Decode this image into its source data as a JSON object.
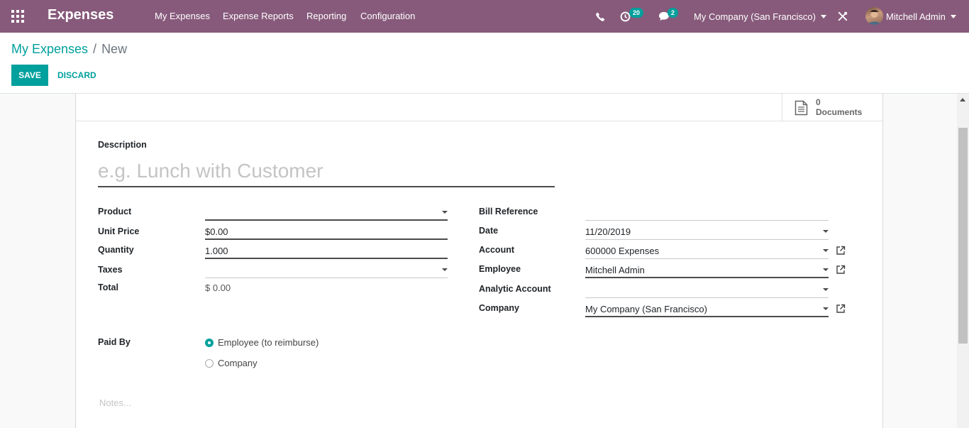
{
  "navbar": {
    "app_name": "Expenses",
    "menus": [
      "My Expenses",
      "Expense Reports",
      "Reporting",
      "Configuration"
    ],
    "activity_count": "20",
    "message_count": "2",
    "company": "My Company (San Francisco)",
    "user": "Mitchell Admin",
    "icons": [
      "apps-icon",
      "phone-icon",
      "activity-clock-icon",
      "chat-icon",
      "debug-tools-icon",
      "avatar"
    ]
  },
  "breadcrumb": {
    "parent": "My Expenses",
    "separator": "/",
    "current": "New"
  },
  "actions": {
    "save": "SAVE",
    "discard": "DISCARD"
  },
  "stat_button": {
    "value": "0",
    "label": "Documents",
    "icon": "document-icon"
  },
  "form": {
    "description_label": "Description",
    "description_placeholder": "e.g. Lunch with Customer",
    "left": {
      "product_label": "Product",
      "product_value": "",
      "unit_price_label": "Unit Price",
      "unit_price_value": "$0.00",
      "quantity_label": "Quantity",
      "quantity_value": "1.000",
      "taxes_label": "Taxes",
      "taxes_value": "",
      "total_label": "Total",
      "total_value": "$ 0.00"
    },
    "right": {
      "bill_reference_label": "Bill Reference",
      "bill_reference_value": "",
      "date_label": "Date",
      "date_value": "11/20/2019",
      "account_label": "Account",
      "account_value": "600000 Expenses",
      "employee_label": "Employee",
      "employee_value": "Mitchell Admin",
      "analytic_account_label": "Analytic Account",
      "analytic_account_value": "",
      "company_label": "Company",
      "company_value": "My Company (San Francisco)"
    },
    "paid_by_label": "Paid By",
    "paid_by_options": [
      "Employee (to reimburse)",
      "Company"
    ],
    "paid_by_selected": "Employee (to reimburse)",
    "notes_placeholder": "Notes..."
  },
  "colors": {
    "navbar": "#875A7B",
    "accent": "#00A09D"
  }
}
